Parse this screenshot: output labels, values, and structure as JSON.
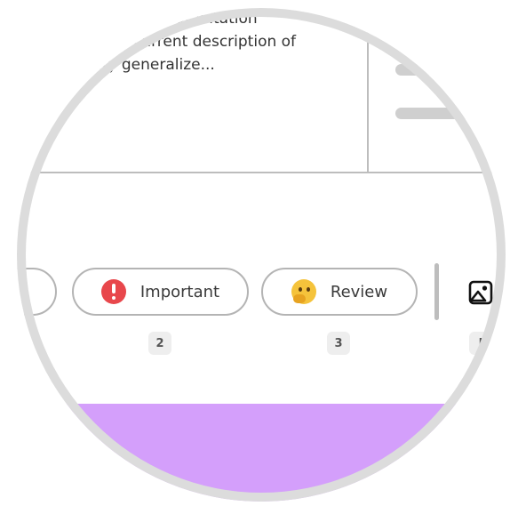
{
  "card": {
    "text_lines": [
      "gravitation",
      "current description of",
      "ity generalize..."
    ]
  },
  "tags": {
    "important": {
      "label": "Important",
      "shortcut": "2",
      "icon": "exclamation-icon"
    },
    "review": {
      "label": "Review",
      "shortcut": "3",
      "icon": "thinking-face-icon"
    }
  },
  "toolbar": {
    "image_shortcut": "I",
    "image_icon": "image-icon"
  },
  "colors": {
    "important_red": "#e8474c",
    "review_yellow": "#f5c33b",
    "accent_purple": "#d49ffb",
    "border_gray": "#b4b4b4"
  }
}
